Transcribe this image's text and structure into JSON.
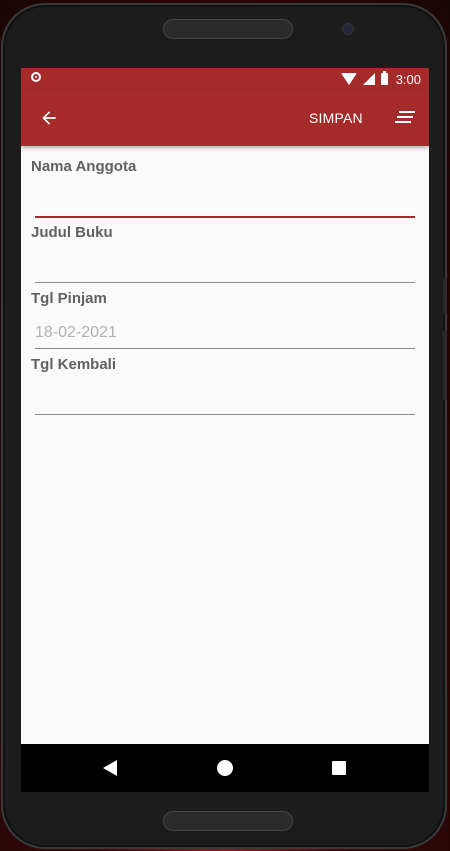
{
  "statusbar": {
    "time": "3:00",
    "icons": [
      "record-icon",
      "wifi-icon",
      "signal-icon",
      "battery-icon"
    ]
  },
  "appbar": {
    "back_icon": "arrow-left-icon",
    "save_label": "SIMPAN",
    "sort_icon": "sort-icon"
  },
  "form": {
    "fields": [
      {
        "label": "Nama Anggota",
        "value": "",
        "placeholder": ""
      },
      {
        "label": "Judul Buku",
        "value": "",
        "placeholder": ""
      },
      {
        "label": "Tgl Pinjam",
        "value": "",
        "placeholder": "18-02-2021"
      },
      {
        "label": "Tgl Kembali",
        "value": "",
        "placeholder": ""
      }
    ]
  },
  "navbar": {
    "icons": [
      "nav-back-icon",
      "nav-home-icon",
      "nav-recent-icon"
    ]
  },
  "colors": {
    "accent": "#a52a2a",
    "background": "#fafafa",
    "label": "#616161",
    "hint": "#b0b0b0"
  }
}
